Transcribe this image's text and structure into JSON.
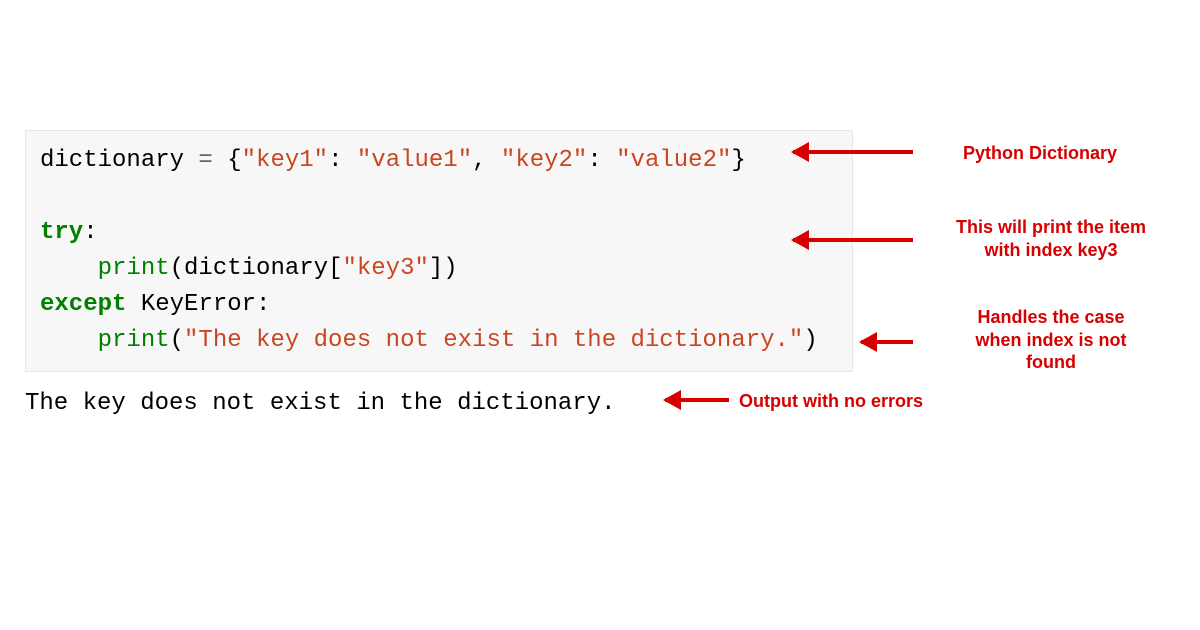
{
  "code": {
    "line1": {
      "var": "dictionary",
      "eq": " = ",
      "lbrace": "{",
      "k1": "\"key1\"",
      "colon1": ": ",
      "v1": "\"value1\"",
      "comma": ", ",
      "k2": "\"key2\"",
      "colon2": ": ",
      "v2": "\"value2\"",
      "rbrace": "}"
    },
    "blank1": "",
    "line3": {
      "kw": "try",
      "colon": ":"
    },
    "line4": {
      "indent": "    ",
      "fn": "print",
      "lp": "(",
      "obj": "dictionary",
      "lbr": "[",
      "key": "\"key3\"",
      "rbr": "]",
      "rp": ")"
    },
    "line5": {
      "kw": "except",
      "sp": " ",
      "exc": "KeyError",
      "colon": ":"
    },
    "line6": {
      "indent": "    ",
      "fn": "print",
      "lp": "(",
      "msg": "\"The key does not exist in the dictionary.\"",
      "rp": ")"
    }
  },
  "output": "The key does not exist in the dictionary.",
  "annotations": {
    "a1": "Python Dictionary",
    "a2": "This will print the item\nwith index key3",
    "a3": "Handles the case\nwhen index is not\nfound",
    "a4": "Output with no errors"
  }
}
